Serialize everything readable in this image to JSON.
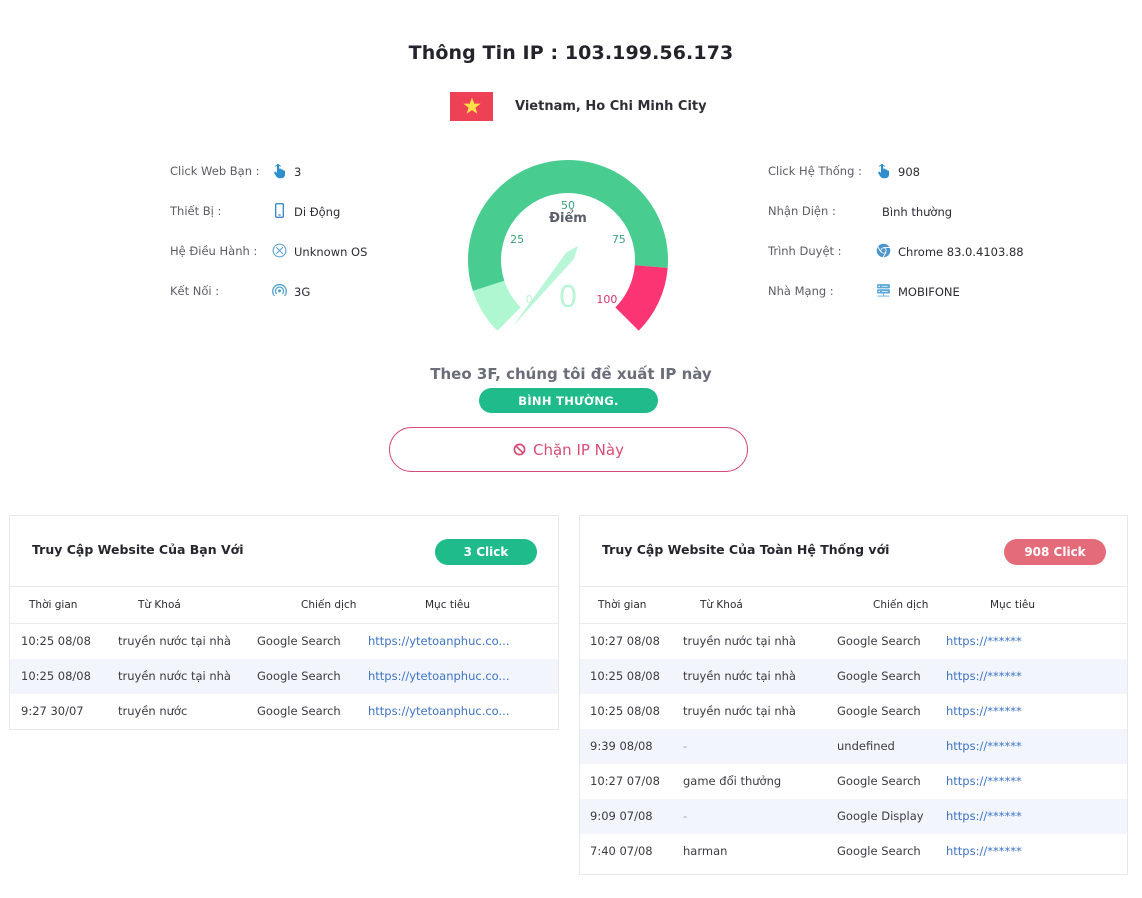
{
  "header": {
    "title": "Thông Tin IP : 103.199.56.173",
    "location": "Vietnam, Ho Chi Minh City",
    "flag_colors": {
      "field": "#ee4155",
      "star": "#ffde4a"
    }
  },
  "info_left": [
    {
      "label": "Click Web Bạn :",
      "icon": "pointer-hand-icon",
      "value": "3"
    },
    {
      "label": "Thiết Bị :",
      "icon": "mobile-phone-icon",
      "value": "Di Động"
    },
    {
      "label": "Hệ Điều Hành :",
      "icon": "unknown-os-icon",
      "value": "Unknown OS"
    },
    {
      "label": "Kết Nối :",
      "icon": "signal-icon",
      "value": "3G"
    }
  ],
  "info_right": [
    {
      "label": "Click Hệ Thống :",
      "icon": "pointer-hand-icon",
      "value": "908"
    },
    {
      "label": "Nhận Diện :",
      "icon": "",
      "value": "Bình thường"
    },
    {
      "label": "Trình Duyệt :",
      "icon": "chrome-icon",
      "value": "Chrome 83.0.4103.88"
    },
    {
      "label": "Nhà Mạng :",
      "icon": "server-network-icon",
      "value": "MOBIFONE"
    }
  ],
  "gauge": {
    "label": "Điểm",
    "value": 0,
    "display_value": "0",
    "min": 0,
    "max": 100,
    "ticks": [
      "0",
      "25",
      "50",
      "75",
      "100"
    ],
    "colors": {
      "low": "#aef7d0",
      "mid": "#48cc90",
      "high": "#fb3473",
      "tick": "#3aa27a",
      "tick_high": "#d6336c",
      "needle": "#b9f6d7"
    },
    "bands": [
      {
        "from": 0,
        "to": 10,
        "color": "#aef7d0"
      },
      {
        "from": 10,
        "to": 85,
        "color": "#48cc90"
      },
      {
        "from": 85,
        "to": 100,
        "color": "#fb3473"
      }
    ]
  },
  "recommendation": {
    "text": "Theo 3F, chúng tôi đề xuất IP này",
    "status": "BÌNH THƯỜNG.",
    "status_color": "#1fbb8a"
  },
  "block_button": {
    "label": "Chặn IP Này",
    "color": "#d64c76"
  },
  "table_website": {
    "title": "Truy Cập Website Của Bạn Với",
    "badge": "3 Click",
    "badge_color": "#1fbb8a",
    "columns": [
      "Thời gian",
      "Từ Khoá",
      "Chiến dịch",
      "Mục tiêu"
    ],
    "rows": [
      [
        "10:25 08/08",
        "truyền nước tại nhà",
        "Google Search",
        "https://ytetoanphuc.co..."
      ],
      [
        "10:25 08/08",
        "truyền nước tại nhà",
        "Google Search",
        "https://ytetoanphuc.co..."
      ],
      [
        "9:27 30/07",
        "truyền nước",
        "Google Search",
        "https://ytetoanphuc.co..."
      ]
    ]
  },
  "table_system": {
    "title": "Truy Cập Website Của Toàn Hệ Thống với",
    "badge": "908 Click",
    "badge_color": "#e46b7a",
    "columns": [
      "Thời gian",
      "Từ Khoá",
      "Chiến dịch",
      "Mục tiêu"
    ],
    "rows": [
      [
        "10:27 08/08",
        "truyền nước tại nhà",
        "Google Search",
        "https://******"
      ],
      [
        "10:25 08/08",
        "truyền nước tại nhà",
        "Google Search",
        "https://******"
      ],
      [
        "10:25 08/08",
        "truyền nước tại nhà",
        "Google Search",
        "https://******"
      ],
      [
        "9:39 08/08",
        "-",
        "undefined",
        "https://******"
      ],
      [
        "10:27 07/08",
        "game đổi thưởng",
        "Google Search",
        "https://******"
      ],
      [
        "9:09 07/08",
        "-",
        "Google Display",
        "https://******"
      ],
      [
        "7:40 07/08",
        "harman",
        "Google Search",
        "https://******"
      ]
    ]
  }
}
